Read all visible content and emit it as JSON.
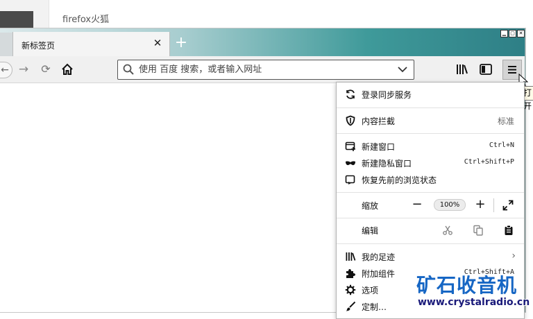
{
  "background_page": {
    "text": "firefox火狐"
  },
  "tabs": [
    {
      "title": "新标签页"
    }
  ],
  "navbar": {
    "url_placeholder": "使用 百度 搜索，或者输入网址"
  },
  "tooltip": {
    "text": "打开"
  },
  "menu": {
    "sync": {
      "label": "登录同步服务",
      "icon": "sync-icon"
    },
    "blocking": {
      "label": "内容拦截",
      "value": "标准",
      "icon": "shield-icon"
    },
    "new_window": {
      "label": "新建窗口",
      "shortcut": "Ctrl+N",
      "icon": "new-window-icon"
    },
    "private_window": {
      "label": "新建隐私窗口",
      "shortcut": "Ctrl+Shift+P",
      "icon": "private-mask-icon"
    },
    "restore_session": {
      "label": "恢复先前的浏览状态",
      "icon": "restore-icon"
    },
    "zoom": {
      "label": "缩放",
      "minus": "−",
      "value": "100%",
      "plus": "+"
    },
    "edit": {
      "label": "编辑"
    },
    "library": {
      "label": "我的足迹",
      "icon": "library-icon"
    },
    "addons": {
      "label": "附加组件",
      "shortcut": "Ctrl+Shift+A",
      "icon": "puzzle-icon"
    },
    "options": {
      "label": "选项",
      "icon": "gear-icon"
    },
    "customize": {
      "label": "定制…",
      "icon": "brush-icon"
    }
  },
  "watermark": {
    "name": "矿石收音机",
    "url": "www.crystalradio.cn"
  }
}
